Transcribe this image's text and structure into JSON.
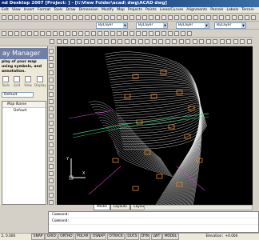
{
  "window": {
    "title": "nd Desktop 2007 [Project:              ] - [I:\\View Folder\\acad\\              dwg\\ACAD         dwg]"
  },
  "menu": [
    "Edit",
    "View",
    "Insert",
    "Format",
    "Tools",
    "Draw",
    "Dimension",
    "Modify",
    "Map",
    "Projects",
    "Points",
    "Lines/Curves",
    "Alignments",
    "Parcels",
    "Labels",
    "Terrain",
    "Inquiry",
    "Utilities",
    "Window"
  ],
  "toolbar": {
    "layer_combo_1": "ByLayer",
    "layer_combo_2": "ByLayer",
    "layer_combo_3": "ByLayer",
    "layer_combo_4": "ByLayer"
  },
  "panel": {
    "title": "ay Manager",
    "description": "play of your map using symbols, and annotation.",
    "buttons": [
      "Tools",
      "Grid",
      "View",
      "Display"
    ],
    "select_value": "Default",
    "table_header": "Map Name",
    "table_rows": [
      "Default"
    ]
  },
  "layout_tabs": [
    "Model",
    "Layout1",
    "Layout2"
  ],
  "command_lines": [
    "Command:",
    "Command:"
  ],
  "status": {
    "coords": "2, 0.000",
    "toggles": [
      "SNAP",
      "GRID",
      "ORTHO",
      "POLAR",
      "OSNAP",
      "OTRACK",
      "DUCS",
      "DYN",
      "LWT",
      "MODEL"
    ],
    "elevation_label": "Elevation:",
    "elevation_value": "+0.000"
  },
  "ucs_icon": {
    "x_label": "X",
    "y_label": "Y"
  },
  "colors": {
    "drawing_bg": "#000000",
    "contour_white": "#e6e6e6",
    "contour_orange": "#d98a3a",
    "contour_green": "#3ad07a",
    "contour_magenta": "#d040d0",
    "titlebar": "#0a246a"
  }
}
